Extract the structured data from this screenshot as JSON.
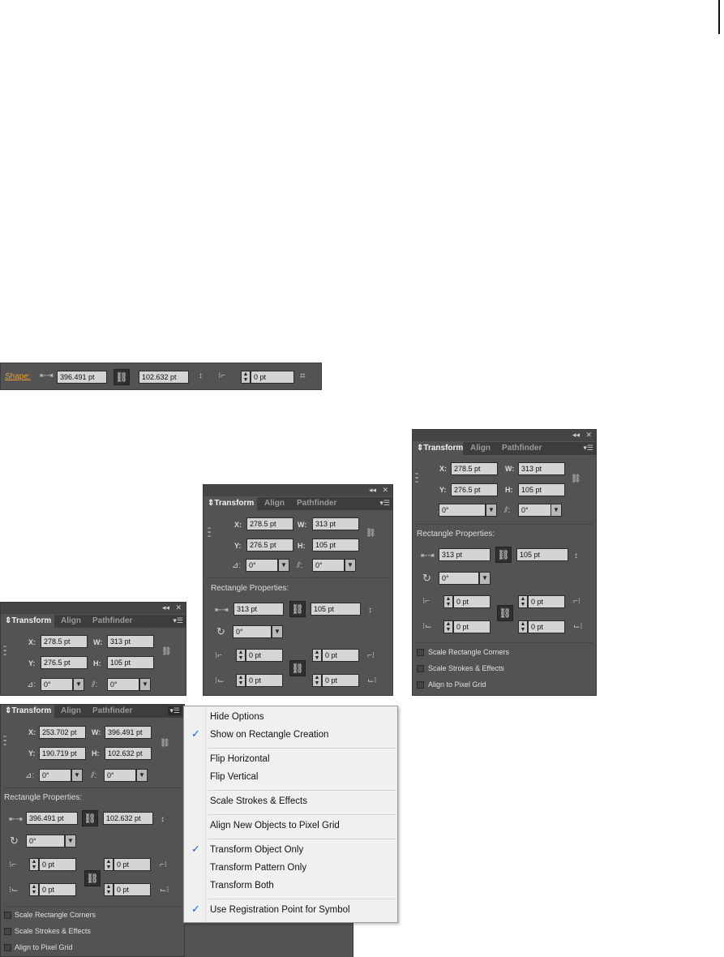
{
  "control_bar": {
    "shape_label": "Shape:",
    "width_value": "396.491 pt",
    "height_value": "102.632 pt",
    "corner_value": "0 pt"
  },
  "panel_tabs": {
    "transform": "Transform",
    "align": "Align",
    "pathfinder": "Pathfinder"
  },
  "labels": {
    "x": "X:",
    "y": "Y:",
    "w": "W:",
    "h": "H:",
    "rect_props": "Rectangle Properties:",
    "scale_corners": "Scale Rectangle Corners",
    "scale_strokes": "Scale Strokes & Effects",
    "align_pixel": "Align to Pixel Grid"
  },
  "panels": {
    "large": {
      "x": "278.5 pt",
      "y": "276.5 pt",
      "w": "313 pt",
      "h": "105 pt",
      "angle": "0°",
      "shear": "0°",
      "rect_w": "313 pt",
      "rect_h": "105 pt",
      "rect_angle": "0°",
      "c1": "0 pt",
      "c2": "0 pt",
      "c3": "0 pt",
      "c4": "0 pt"
    },
    "medium": {
      "x": "278.5 pt",
      "y": "276.5 pt",
      "w": "313 pt",
      "h": "105 pt",
      "angle": "0°",
      "shear": "0°",
      "rect_w": "313 pt",
      "rect_h": "105 pt",
      "rect_angle": "0°",
      "c1": "0 pt",
      "c2": "0 pt",
      "c3": "0 pt",
      "c4": "0 pt"
    },
    "small": {
      "x": "278.5 pt",
      "y": "276.5 pt",
      "w": "313 pt",
      "h": "105 pt",
      "angle": "0°",
      "shear": "0°"
    },
    "bottom": {
      "x": "253.702 pt",
      "y": "190.719 pt",
      "w": "396.491 pt",
      "h": "102.632 pt",
      "angle": "0°",
      "shear": "0°",
      "rect_w": "396.491 pt",
      "rect_h": "102.632 pt",
      "rect_angle": "0°",
      "c1": "0 pt",
      "c2": "0 pt",
      "c3": "0 pt",
      "c4": "0 pt"
    }
  },
  "flyout_menu": {
    "hide_options": "Hide Options",
    "show_on_rect": "Show on Rectangle Creation",
    "flip_h": "Flip Horizontal",
    "flip_v": "Flip Vertical",
    "scale_strokes": "Scale Strokes & Effects",
    "align_new": "Align New Objects to Pixel Grid",
    "transform_object": "Transform Object Only",
    "transform_pattern": "Transform Pattern Only",
    "transform_both": "Transform Both",
    "use_registration": "Use Registration Point for Symbol"
  },
  "icons": {
    "close": "close-icon",
    "collapse": "collapse-double-arrow-icon",
    "menu": "panel-menu-icon",
    "link": "chain-link-icon",
    "reference_point": "reference-point-grid-icon",
    "rotate": "rotate-icon",
    "checkmark": "checkmark-icon"
  },
  "colors": {
    "panel_bg": "#535353",
    "tab_bar": "#3d3d3d",
    "shape_link": "#f0a030",
    "menu_bg": "#f0f0f0",
    "check": "#1f5fbf"
  }
}
